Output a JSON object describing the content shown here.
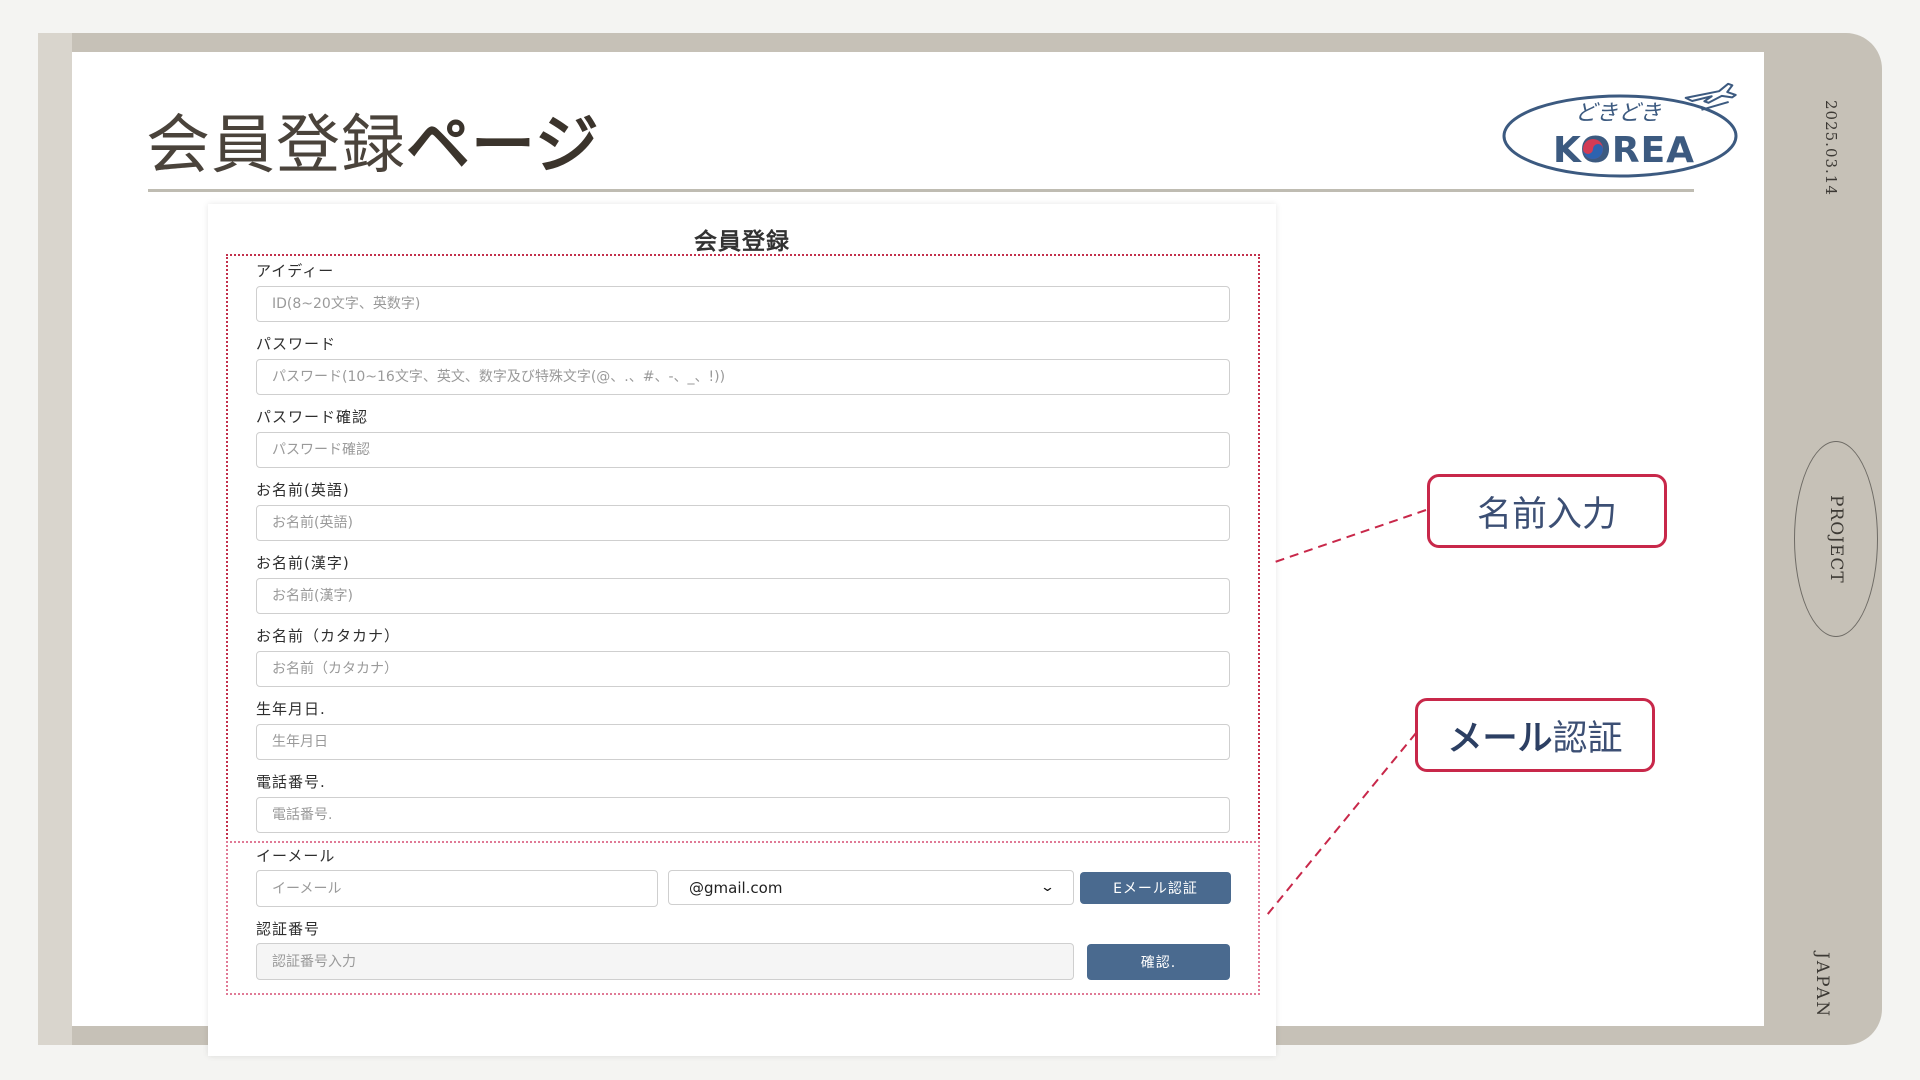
{
  "slide": {
    "title_light": "会員登録",
    "title_bold": "ページ",
    "date": "2025.03.14",
    "side_badge": "PROJECT",
    "side_footer": "JAPAN",
    "logo": {
      "top_text": "どきどき",
      "main_text": "KOREA",
      "icon": "airplane-icon"
    }
  },
  "form": {
    "title": "会員登録",
    "fields": [
      {
        "label": "アイディー",
        "placeholder": "ID(8~20文字、英数字)"
      },
      {
        "label": "パスワード",
        "placeholder": "パスワード(10~16文字、英文、数字及び特殊文字(@、.、#、-、_、!))"
      },
      {
        "label": "パスワード確認",
        "placeholder": "パスワード確認"
      },
      {
        "label": "お名前(英語)",
        "placeholder": "お名前(英語)"
      },
      {
        "label": "お名前(漢字)",
        "placeholder": "お名前(漢字)"
      },
      {
        "label": "お名前（カタカナ）",
        "placeholder": "お名前（カタカナ）"
      },
      {
        "label": "生年月日.",
        "placeholder": "生年月日"
      },
      {
        "label": "電話番号.",
        "placeholder": "電話番号."
      }
    ],
    "email": {
      "label": "イーメール",
      "placeholder": "イーメール",
      "domain_selected": "@gmail.com",
      "verify_button": "Eメール認証"
    },
    "auth": {
      "label": "認証番号",
      "placeholder": "認証番号入力",
      "confirm_button": "確認."
    }
  },
  "callouts": {
    "name_input": "名前入力",
    "mail_bold": "メール",
    "mail_rest": "認証"
  },
  "colors": {
    "accent_red": "#c8284a",
    "button_blue": "#4a6a8f",
    "frame": "#c6c1b7"
  }
}
